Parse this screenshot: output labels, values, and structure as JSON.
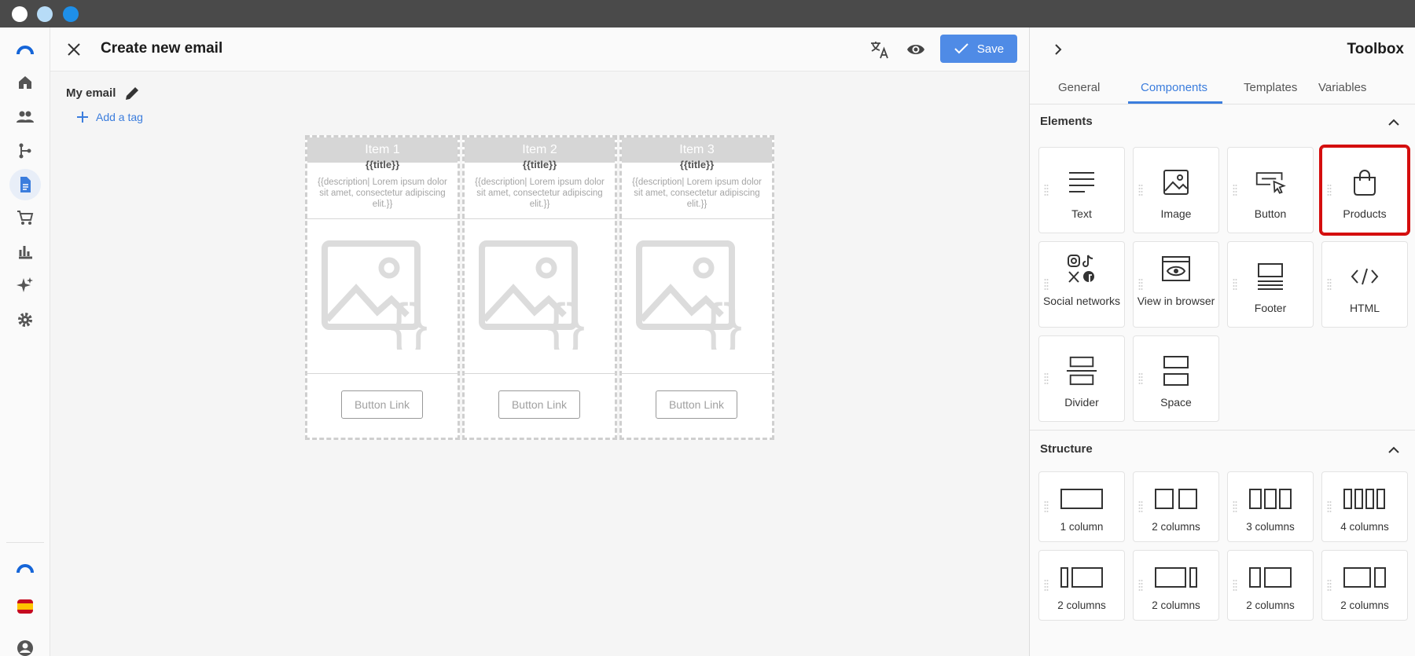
{
  "header": {
    "title": "Create new email",
    "save_label": "Save"
  },
  "canvas": {
    "email_name": "My email",
    "add_tag_label": "Add a tag",
    "products": [
      {
        "heading": "Item 1",
        "title": "{{title}}",
        "description": "{{description| Lorem ipsum dolor sit amet, consectetur adipiscing elit.}}",
        "button": "Button Link"
      },
      {
        "heading": "Item 2",
        "title": "{{title}}",
        "description": "{{description| Lorem ipsum dolor sit amet, consectetur adipiscing elit.}}",
        "button": "Button Link"
      },
      {
        "heading": "Item 3",
        "title": "{{title}}",
        "description": "{{description| Lorem ipsum dolor sit amet, consectetur adipiscing elit.}}",
        "button": "Button Link"
      }
    ]
  },
  "toolbox": {
    "title": "Toolbox",
    "tabs": [
      "General",
      "Components",
      "Templates",
      "Variables"
    ],
    "active_tab": "Components",
    "elements_title": "Elements",
    "structure_title": "Structure",
    "elements": [
      {
        "label": "Text",
        "icon": "text-icon"
      },
      {
        "label": "Image",
        "icon": "image-icon"
      },
      {
        "label": "Button",
        "icon": "button-icon"
      },
      {
        "label": "Products",
        "icon": "shopping-bag-icon"
      },
      {
        "label": "Social networks",
        "icon": "social-networks-icon"
      },
      {
        "label": "View in browser",
        "icon": "view-in-browser-icon"
      },
      {
        "label": "Footer",
        "icon": "footer-icon"
      },
      {
        "label": "HTML",
        "icon": "code-icon"
      },
      {
        "label": "Divider",
        "icon": "divider-icon"
      },
      {
        "label": "Space",
        "icon": "space-icon"
      }
    ],
    "structures": [
      {
        "label": "1 column"
      },
      {
        "label": "2 columns"
      },
      {
        "label": "3 columns"
      },
      {
        "label": "4 columns"
      },
      {
        "label": "2 columns"
      },
      {
        "label": "2 columns"
      },
      {
        "label": "2 columns"
      },
      {
        "label": "2 columns"
      }
    ]
  },
  "colors": {
    "accent": "#4f8be6",
    "highlight": "#d40d0d",
    "chrome": "#4a4a4a"
  }
}
